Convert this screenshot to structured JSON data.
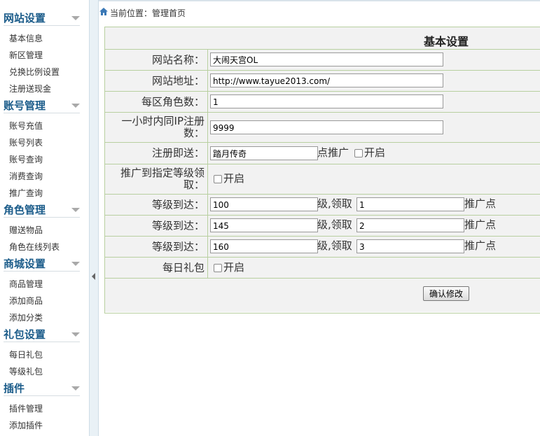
{
  "breadcrumb": {
    "text": "当前位置：管理首页"
  },
  "sidebar": {
    "groups": [
      {
        "title": "网站设置",
        "items": [
          "基本信息",
          "新区管理",
          "兑换比例设置",
          "注册送现金"
        ]
      },
      {
        "title": "账号管理",
        "items": [
          "账号充值",
          "账号列表",
          "账号查询",
          "消费查询",
          "推广查询"
        ]
      },
      {
        "title": "角色管理",
        "items": [
          "赠送物品",
          "角色在线列表"
        ]
      },
      {
        "title": "商城设置",
        "items": [
          "商品管理",
          "添加商品",
          "添加分类"
        ]
      },
      {
        "title": "礼包设置",
        "items": [
          "每日礼包",
          "等级礼包"
        ]
      },
      {
        "title": "插件",
        "items": [
          "插件管理",
          "添加插件"
        ]
      }
    ]
  },
  "form": {
    "title": "基本设置",
    "site_name": {
      "label": "网站名称：",
      "value": "大闹天宫OL"
    },
    "site_url": {
      "label": "网站地址：",
      "value": "http://www.tayue2013.com/"
    },
    "roles_per_zone": {
      "label": "每区角色数：",
      "value": "1"
    },
    "ip_limit": {
      "label": "一小时内同IP注册数：",
      "value": "9999"
    },
    "register_gift": {
      "label": "注册即送：",
      "value": "踏月传奇",
      "suffix": "点推广",
      "toggle": "开启"
    },
    "level_reward": {
      "label": "推广到指定等级领取：",
      "toggle": "开启"
    },
    "level_rows": [
      {
        "label": "等级到达：",
        "level": "100",
        "mid": "级,领取",
        "points": "1",
        "suffix": "推广点"
      },
      {
        "label": "等级到达：",
        "level": "145",
        "mid": "级,领取",
        "points": "2",
        "suffix": "推广点"
      },
      {
        "label": "等级到达：",
        "level": "160",
        "mid": "级,领取",
        "points": "3",
        "suffix": "推广点"
      }
    ],
    "daily_gift": {
      "label": "每日礼包",
      "toggle": "开启"
    },
    "submit_label": "确认修改"
  }
}
